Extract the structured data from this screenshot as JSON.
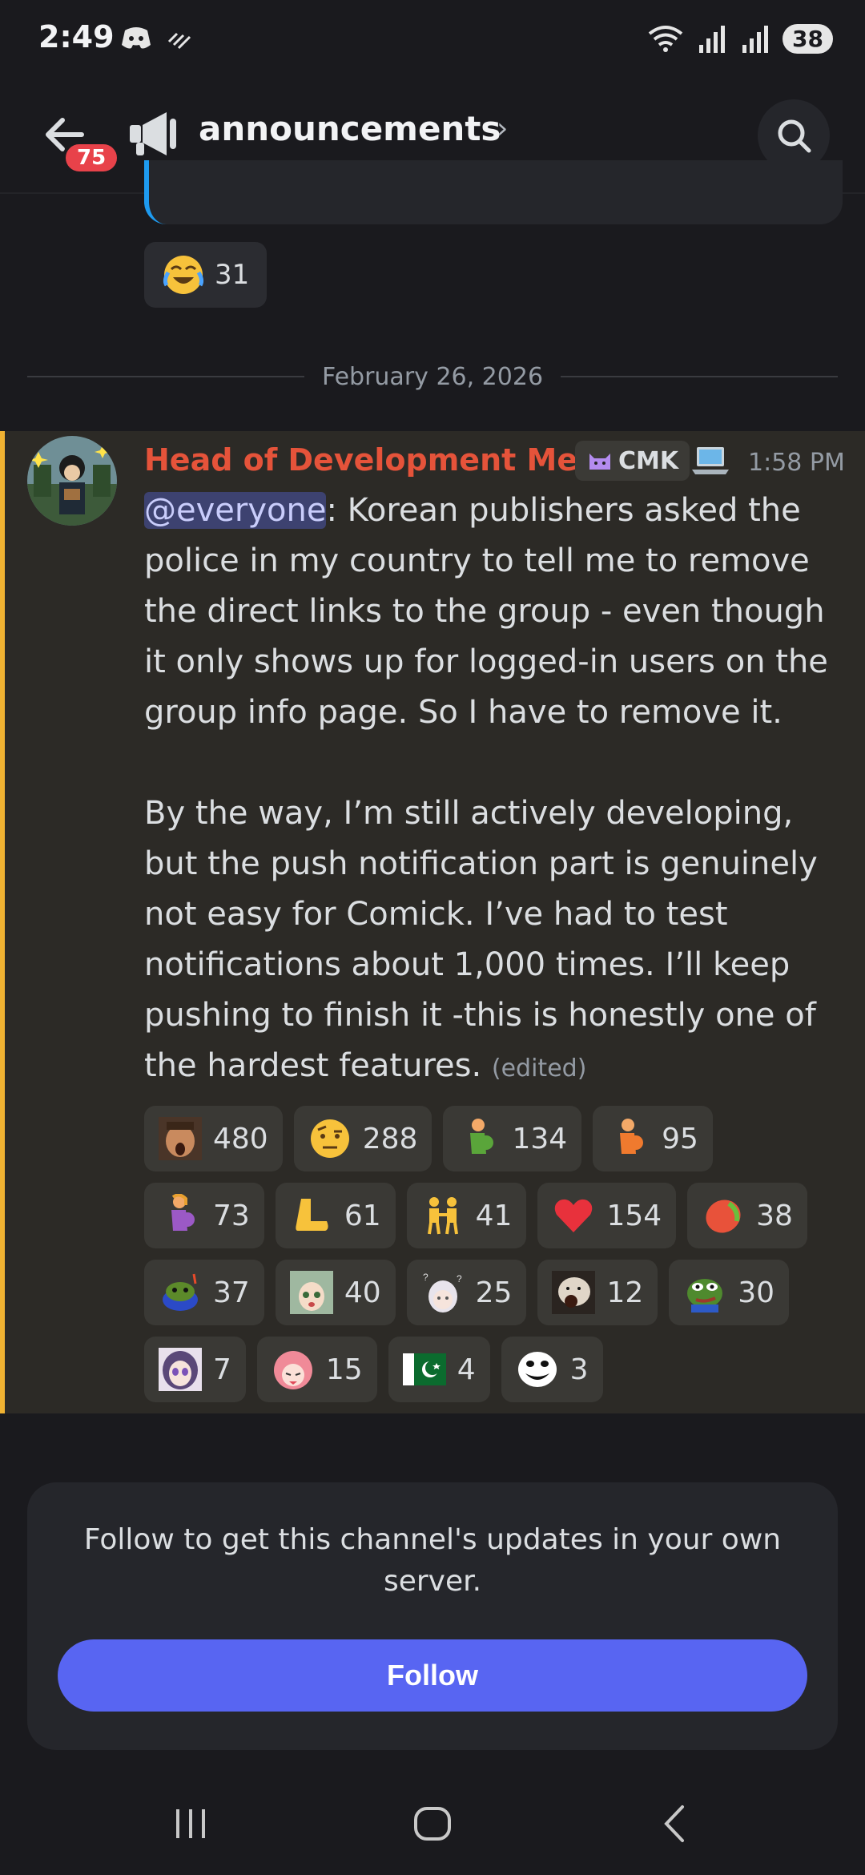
{
  "status_bar": {
    "time": "2:49",
    "battery": "38"
  },
  "header": {
    "back_badge": "75",
    "channel_name": "announcements"
  },
  "previous_message": {
    "reaction_count": "31"
  },
  "date_divider": "February 26, 2026",
  "message": {
    "author": "Head of Development Me...",
    "tag": "CMK",
    "timestamp": "1:58 PM",
    "mention": "@everyone",
    "paragraph1": ": Korean publishers asked the police in my country to tell me to remove the direct links to the group - even though it only shows up for logged-in users on the group info page. So I have to remove it.",
    "paragraph2": "By the way, I’m still actively developing, but the push notification part is genuinely not easy for Comick. I’ve had to test notifications about 1,000 times. I’ll keep pushing to finish it -this is honestly one of the hardest features.",
    "edited": "(edited)",
    "author_color": "#e5533a",
    "accent_bar_color": "#f0b232",
    "reactions": [
      {
        "icon": "man-face-icon",
        "count": "480"
      },
      {
        "icon": "raised-eyebrow-icon",
        "count": "288"
      },
      {
        "icon": "pregnant-man-icon",
        "count": "134"
      },
      {
        "icon": "pregnant-person-icon",
        "count": "95"
      },
      {
        "icon": "pregnant-woman-icon",
        "count": "73"
      },
      {
        "icon": "foot-icon",
        "count": "61"
      },
      {
        "icon": "people-holding-hands-icon",
        "count": "41"
      },
      {
        "icon": "heart-icon",
        "count": "154"
      },
      {
        "icon": "mango-icon",
        "count": "38"
      },
      {
        "icon": "pepe-hat-icon",
        "count": "37"
      },
      {
        "icon": "anime-girl-surprised-icon",
        "count": "40"
      },
      {
        "icon": "anime-girl-confused-icon",
        "count": "25"
      },
      {
        "icon": "dog-yelling-icon",
        "count": "12"
      },
      {
        "icon": "pepe-frog-icon",
        "count": "30"
      },
      {
        "icon": "anime-girl-purple-icon",
        "count": "7"
      },
      {
        "icon": "anime-girl-pink-icon",
        "count": "15"
      },
      {
        "icon": "pakistan-flag-icon",
        "count": "4"
      },
      {
        "icon": "trollface-icon",
        "count": "3"
      }
    ]
  },
  "follow_card": {
    "text": "Follow to get this channel's updates in your own server.",
    "button_label": "Follow",
    "button_color": "#5865f2"
  }
}
